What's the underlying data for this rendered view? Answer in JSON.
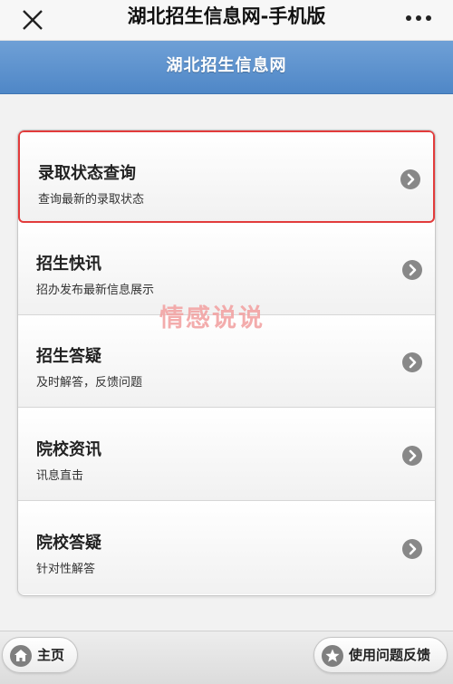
{
  "topbar": {
    "title": "湖北招生信息网-手机版",
    "close_icon": "close-icon",
    "more_icon": "more-icon"
  },
  "header": {
    "title": "湖北招生信息网"
  },
  "menu": {
    "items": [
      {
        "title": "录取状态查询",
        "subtitle": "查询最新的录取状态",
        "icon": "chevron-right-icon"
      },
      {
        "title": "招生快讯",
        "subtitle": "招办发布最新信息展示",
        "icon": "chevron-right-icon"
      },
      {
        "title": "招生答疑",
        "subtitle": "及时解答，反馈问题",
        "icon": "chevron-right-icon"
      },
      {
        "title": "院校资讯",
        "subtitle": "讯息直击",
        "icon": "chevron-right-icon"
      },
      {
        "title": "院校答疑",
        "subtitle": "针对性解答",
        "icon": "chevron-right-icon"
      }
    ]
  },
  "watermark": "情感说说",
  "footer": {
    "home_label": "主页",
    "feedback_label": "使用问题反馈",
    "home_icon": "home-icon",
    "feedback_icon": "star-icon"
  },
  "colors": {
    "header_blue": "#5a8fcd",
    "highlight_red": "#e23b3b",
    "arrow_gray": "#888888"
  }
}
